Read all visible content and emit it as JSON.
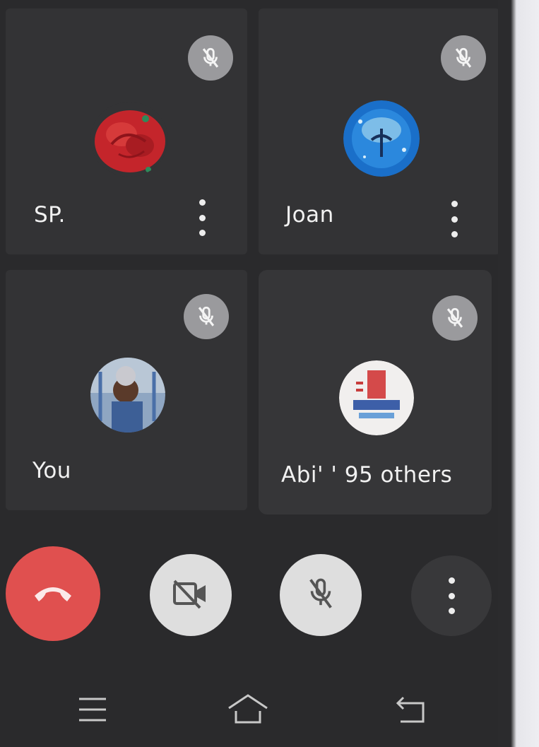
{
  "participants": [
    {
      "name": "SP.",
      "avatar": "red-rose-avatar",
      "muted": true
    },
    {
      "name": "Joan",
      "avatar": "blue-globe-avatar",
      "muted": true
    },
    {
      "name": "You",
      "avatar": "child-photo-avatar",
      "muted": true
    },
    {
      "name": "Abi' ' 95 others",
      "avatar": "group-logo-avatar",
      "muted": true
    }
  ],
  "controls": {
    "end_call": "phone-hangup-icon",
    "camera": "camera-off-icon",
    "microphone": "mic-off-icon",
    "more": "more-vert-icon"
  },
  "system_nav": {
    "menu": "menu-icon",
    "home": "home-icon",
    "back": "back-icon"
  },
  "colors": {
    "background": "#2a2a2c",
    "tile": "#333335",
    "end_call": "#e0504f",
    "control_button": "#dedede",
    "mute_badge": "#9a9a9d"
  }
}
